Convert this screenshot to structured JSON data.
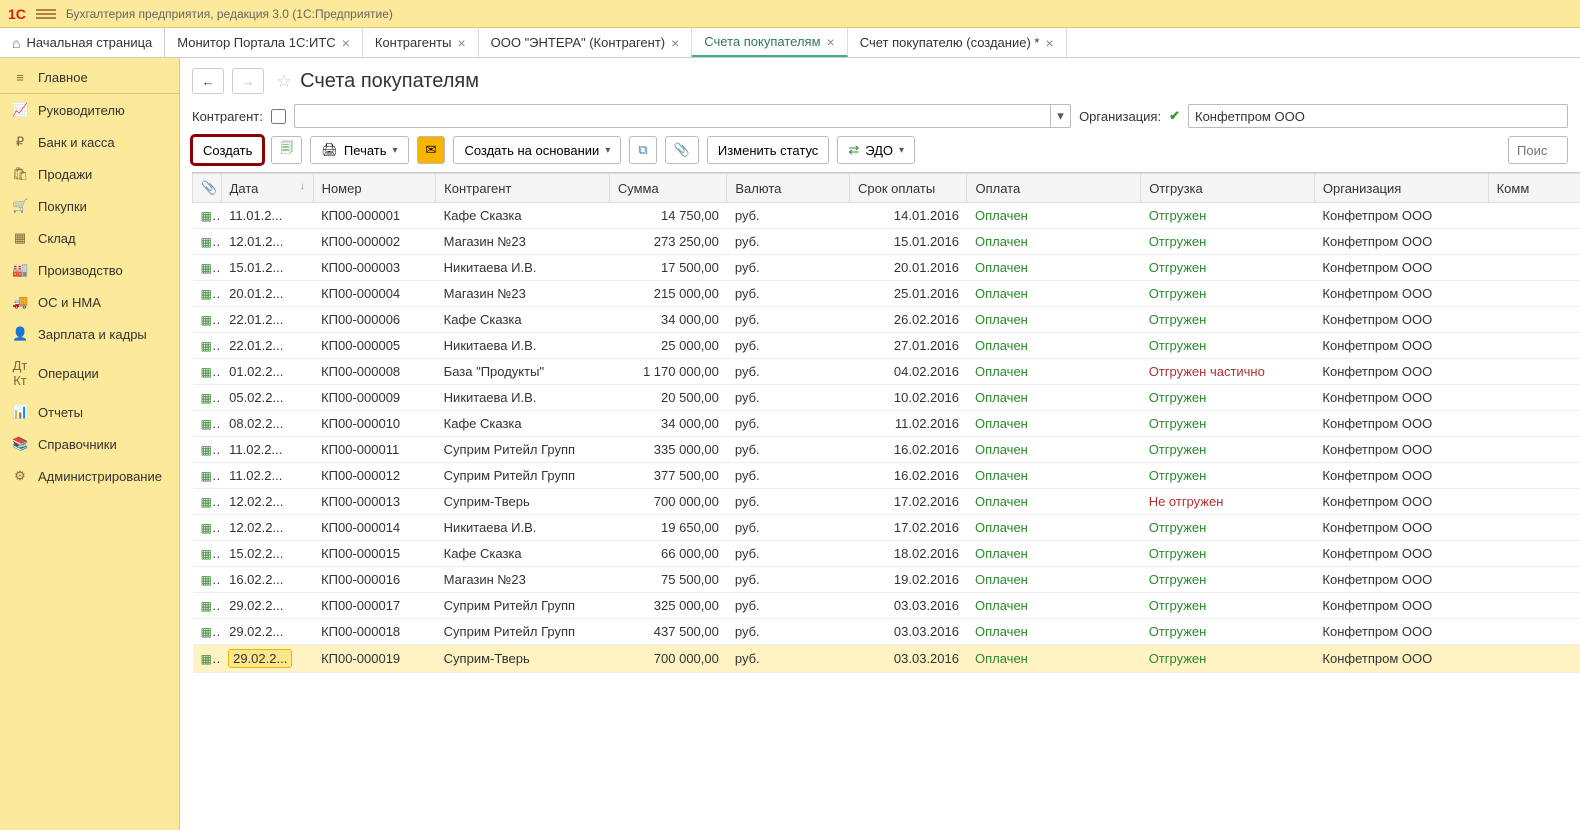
{
  "titlebar": {
    "logo": "1C",
    "app_title": "Бухгалтерия предприятия, редакция 3.0   (1С:Предприятие)"
  },
  "tabs": {
    "home": "Начальная страница",
    "items": [
      {
        "label": "Монитор Портала 1С:ИТС",
        "active": false
      },
      {
        "label": "Контрагенты",
        "active": false
      },
      {
        "label": "ООО \"ЭНТЕРА\" (Контрагент)",
        "active": false
      },
      {
        "label": "Счета покупателям",
        "active": true
      },
      {
        "label": "Счет покупателю (создание) *",
        "active": false
      }
    ]
  },
  "sidebar": {
    "items": [
      {
        "icon": "≡",
        "label": "Главное"
      },
      {
        "icon": "📈",
        "label": "Руководителю"
      },
      {
        "icon": "₽",
        "label": "Банк и касса"
      },
      {
        "icon": "🛍",
        "label": "Продажи"
      },
      {
        "icon": "🛒",
        "label": "Покупки"
      },
      {
        "icon": "▦",
        "label": "Склад"
      },
      {
        "icon": "🏭",
        "label": "Производство"
      },
      {
        "icon": "🚚",
        "label": "ОС и НМА"
      },
      {
        "icon": "👤",
        "label": "Зарплата и кадры"
      },
      {
        "icon": "Дт Кт",
        "label": "Операции"
      },
      {
        "icon": "📊",
        "label": "Отчеты"
      },
      {
        "icon": "📚",
        "label": "Справочники"
      },
      {
        "icon": "⚙",
        "label": "Администрирование"
      }
    ]
  },
  "page": {
    "title": "Счета покупателям"
  },
  "filter": {
    "counterparty_label": "Контрагент:",
    "org_label": "Организация:",
    "org_value": "Конфетпром ООО"
  },
  "toolbar": {
    "create": "Создать",
    "print": "Печать",
    "create_based": "Создать на основании",
    "change_status": "Изменить статус",
    "edo": "ЭДО",
    "search_placeholder": "Поис"
  },
  "columns": {
    "attach": "📎",
    "date": "Дата",
    "number": "Номер",
    "counterparty": "Контрагент",
    "sum": "Сумма",
    "currency": "Валюта",
    "due": "Срок оплаты",
    "payment": "Оплата",
    "shipment": "Отгрузка",
    "org": "Организация",
    "comment": "Комм"
  },
  "rows": [
    {
      "date": "11.01.2...",
      "number": "КП00-000001",
      "counterparty": "Кафе Сказка",
      "sum": "14 750,00",
      "currency": "руб.",
      "due": "14.01.2016",
      "payment": "Оплачен",
      "shipment": "Отгружен",
      "org": "Конфетпром ООО"
    },
    {
      "date": "12.01.2...",
      "number": "КП00-000002",
      "counterparty": "Магазин №23",
      "sum": "273 250,00",
      "currency": "руб.",
      "due": "15.01.2016",
      "payment": "Оплачен",
      "shipment": "Отгружен",
      "org": "Конфетпром ООО"
    },
    {
      "date": "15.01.2...",
      "number": "КП00-000003",
      "counterparty": "Никитаева И.В.",
      "sum": "17 500,00",
      "currency": "руб.",
      "due": "20.01.2016",
      "payment": "Оплачен",
      "shipment": "Отгружен",
      "org": "Конфетпром ООО"
    },
    {
      "date": "20.01.2...",
      "number": "КП00-000004",
      "counterparty": "Магазин №23",
      "sum": "215 000,00",
      "currency": "руб.",
      "due": "25.01.2016",
      "payment": "Оплачен",
      "shipment": "Отгружен",
      "org": "Конфетпром ООО"
    },
    {
      "date": "22.01.2...",
      "number": "КП00-000006",
      "counterparty": "Кафе Сказка",
      "sum": "34 000,00",
      "currency": "руб.",
      "due": "26.02.2016",
      "payment": "Оплачен",
      "shipment": "Отгружен",
      "org": "Конфетпром ООО"
    },
    {
      "date": "22.01.2...",
      "number": "КП00-000005",
      "counterparty": "Никитаева И.В.",
      "sum": "25 000,00",
      "currency": "руб.",
      "due": "27.01.2016",
      "payment": "Оплачен",
      "shipment": "Отгружен",
      "org": "Конфетпром ООО"
    },
    {
      "date": "01.02.2...",
      "number": "КП00-000008",
      "counterparty": "База \"Продукты\"",
      "sum": "1 170 000,00",
      "currency": "руб.",
      "due": "04.02.2016",
      "payment": "Оплачен",
      "shipment": "Отгружен частично",
      "ship_color": "red",
      "org": "Конфетпром ООО"
    },
    {
      "date": "05.02.2...",
      "number": "КП00-000009",
      "counterparty": "Никитаева И.В.",
      "sum": "20 500,00",
      "currency": "руб.",
      "due": "10.02.2016",
      "payment": "Оплачен",
      "shipment": "Отгружен",
      "org": "Конфетпром ООО"
    },
    {
      "date": "08.02.2...",
      "number": "КП00-000010",
      "counterparty": "Кафе Сказка",
      "sum": "34 000,00",
      "currency": "руб.",
      "due": "11.02.2016",
      "payment": "Оплачен",
      "shipment": "Отгружен",
      "org": "Конфетпром ООО"
    },
    {
      "date": "11.02.2...",
      "number": "КП00-000011",
      "counterparty": "Суприм Ритейл Групп",
      "sum": "335 000,00",
      "currency": "руб.",
      "due": "16.02.2016",
      "payment": "Оплачен",
      "shipment": "Отгружен",
      "org": "Конфетпром ООО"
    },
    {
      "date": "11.02.2...",
      "number": "КП00-000012",
      "counterparty": "Суприм Ритейл Групп",
      "sum": "377 500,00",
      "currency": "руб.",
      "due": "16.02.2016",
      "payment": "Оплачен",
      "shipment": "Отгружен",
      "org": "Конфетпром ООО"
    },
    {
      "date": "12.02.2...",
      "number": "КП00-000013",
      "counterparty": "Суприм-Тверь",
      "sum": "700 000,00",
      "currency": "руб.",
      "due": "17.02.2016",
      "payment": "Оплачен",
      "shipment": "Не отгружен",
      "ship_color": "red",
      "org": "Конфетпром ООО"
    },
    {
      "date": "12.02.2...",
      "number": "КП00-000014",
      "counterparty": "Никитаева И.В.",
      "sum": "19 650,00",
      "currency": "руб.",
      "due": "17.02.2016",
      "payment": "Оплачен",
      "shipment": "Отгружен",
      "org": "Конфетпром ООО"
    },
    {
      "date": "15.02.2...",
      "number": "КП00-000015",
      "counterparty": "Кафе Сказка",
      "sum": "66 000,00",
      "currency": "руб.",
      "due": "18.02.2016",
      "payment": "Оплачен",
      "shipment": "Отгружен",
      "org": "Конфетпром ООО"
    },
    {
      "date": "16.02.2...",
      "number": "КП00-000016",
      "counterparty": "Магазин №23",
      "sum": "75 500,00",
      "currency": "руб.",
      "due": "19.02.2016",
      "payment": "Оплачен",
      "shipment": "Отгружен",
      "org": "Конфетпром ООО"
    },
    {
      "date": "29.02.2...",
      "number": "КП00-000017",
      "counterparty": "Суприм Ритейл Групп",
      "sum": "325 000,00",
      "currency": "руб.",
      "due": "03.03.2016",
      "payment": "Оплачен",
      "shipment": "Отгружен",
      "org": "Конфетпром ООО"
    },
    {
      "date": "29.02.2...",
      "number": "КП00-000018",
      "counterparty": "Суприм Ритейл Групп",
      "sum": "437 500,00",
      "currency": "руб.",
      "due": "03.03.2016",
      "payment": "Оплачен",
      "shipment": "Отгружен",
      "org": "Конфетпром ООО"
    },
    {
      "date": "29.02.2...",
      "number": "КП00-000019",
      "counterparty": "Суприм-Тверь",
      "sum": "700 000,00",
      "currency": "руб.",
      "due": "03.03.2016",
      "payment": "Оплачен",
      "shipment": "Отгружен",
      "org": "Конфетпром ООО",
      "selected": true
    }
  ]
}
